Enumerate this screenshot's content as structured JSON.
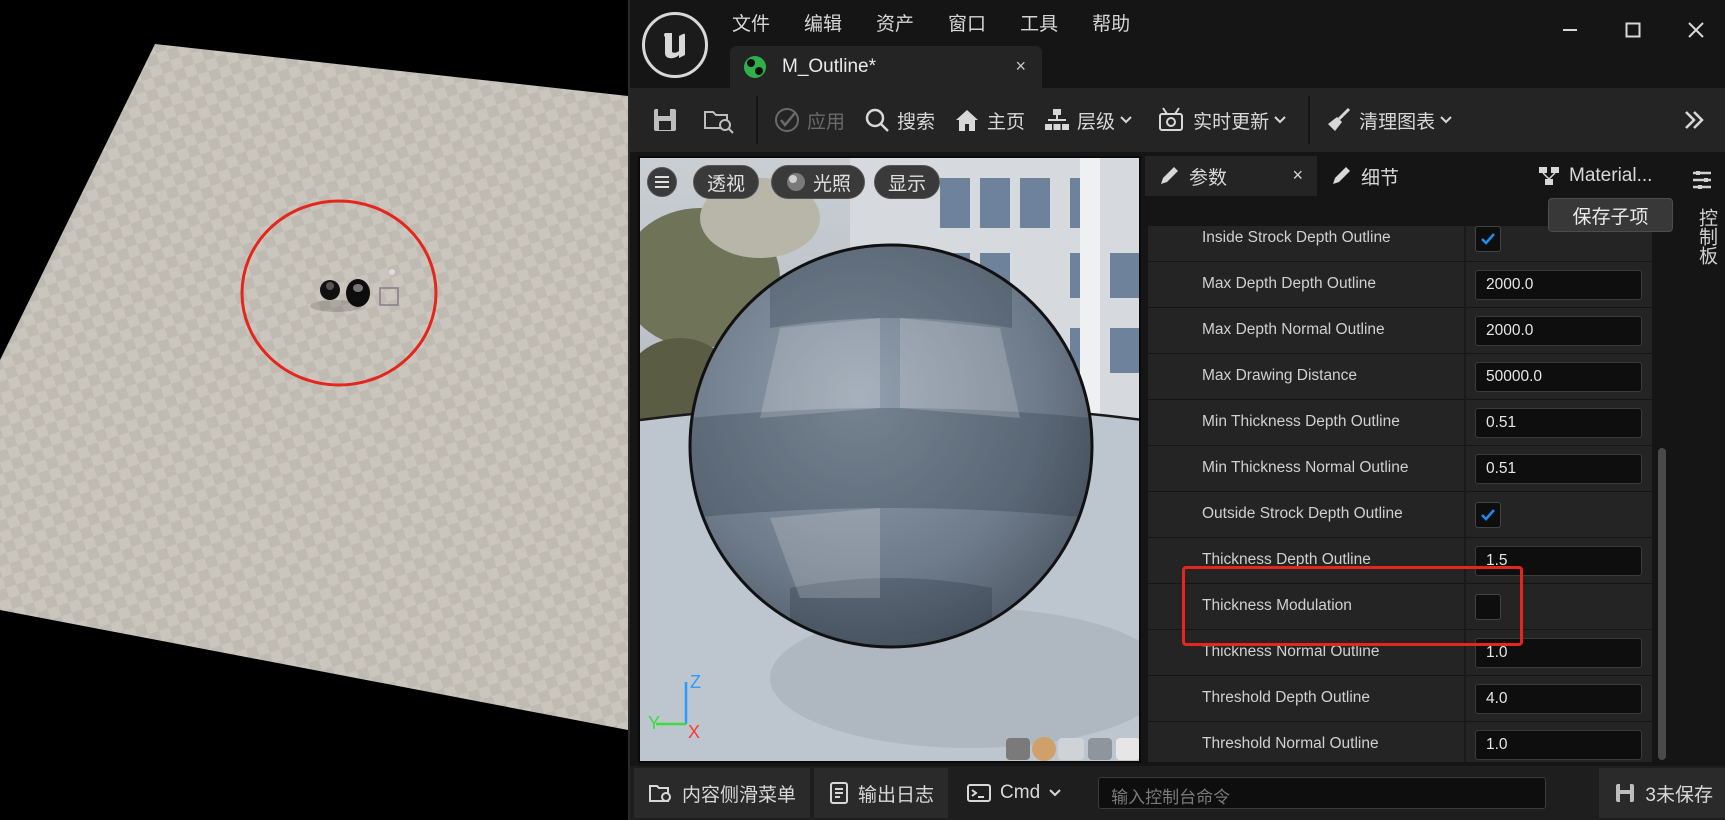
{
  "menu": [
    "文件",
    "编辑",
    "资产",
    "窗口",
    "工具",
    "帮助"
  ],
  "document_tab": {
    "title": "M_Outline*",
    "close": "×"
  },
  "toolbar": {
    "apply": "应用",
    "search": "搜索",
    "home": "主页",
    "hierarchy": "层级",
    "live_update": "实时更新",
    "clean_graph": "清理图表"
  },
  "viewport": {
    "perspective": "透视",
    "lighting": "光照",
    "show": "显示",
    "axis_z": "Z",
    "axis_y": "Y",
    "axis_x": "X"
  },
  "panel_tabs": {
    "params": "参数",
    "details": "细节",
    "material": "Material...",
    "close": "×"
  },
  "save_child": "保存子项",
  "side_panel_label": "控制板",
  "parameters": [
    {
      "name": "Inside Strock Depth Outline",
      "type": "bool",
      "checked": true
    },
    {
      "name": "Max Depth Depth Outline",
      "type": "value",
      "value": "2000.0"
    },
    {
      "name": "Max Depth Normal Outline",
      "type": "value",
      "value": "2000.0"
    },
    {
      "name": "Max Drawing Distance",
      "type": "value",
      "value": "50000.0"
    },
    {
      "name": "Min Thickness Depth Outline",
      "type": "value",
      "value": "0.51"
    },
    {
      "name": "Min Thickness Normal Outline",
      "type": "value",
      "value": "0.51"
    },
    {
      "name": "Outside Strock Depth Outline",
      "type": "bool",
      "checked": true
    },
    {
      "name": "Thickness Depth Outline",
      "type": "value",
      "value": "1.5"
    },
    {
      "name": "Thickness Modulation",
      "type": "bool",
      "checked": false
    },
    {
      "name": "Thickness Normal Outline",
      "type": "value",
      "value": "1.0"
    },
    {
      "name": "Threshold Depth Outline",
      "type": "value",
      "value": "4.0"
    },
    {
      "name": "Threshold Normal Outline",
      "type": "value",
      "value": "1.0"
    }
  ],
  "statusbar": {
    "content_drawer": "内容侧滑菜单",
    "output_log": "输出日志",
    "cmd": "Cmd",
    "console_placeholder": "输入控制台命令",
    "unsaved": "3未保存"
  },
  "colors": {
    "accent": "#1d8cf0",
    "highlight": "#e5261d",
    "checked": "#1d8cf0"
  }
}
